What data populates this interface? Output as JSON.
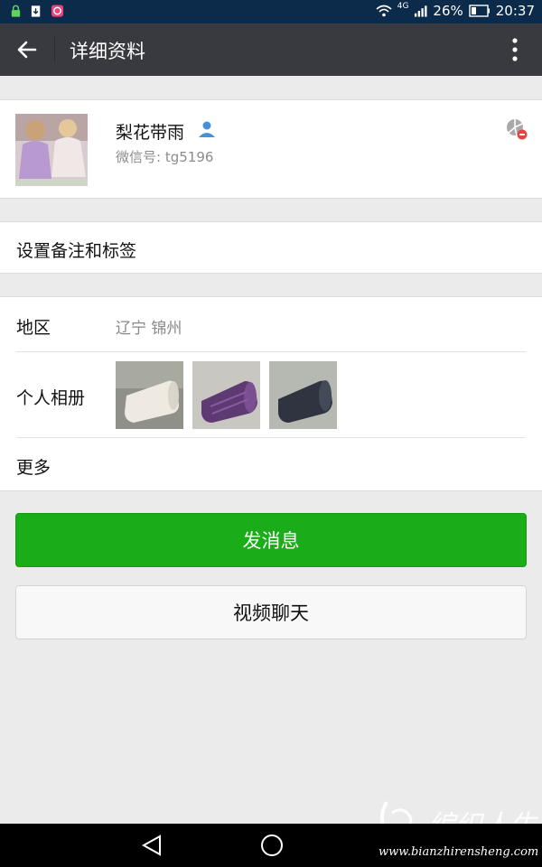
{
  "status_bar": {
    "network": "4G",
    "battery": "26%",
    "time": "20:37"
  },
  "top_bar": {
    "title": "详细资料"
  },
  "profile": {
    "name": "梨花带雨",
    "wxid_label": "微信号: ",
    "wxid_value": "tg5196"
  },
  "remark": {
    "label": "设置备注和标签"
  },
  "info": {
    "region_label": "地区",
    "region_value": "辽宁  锦州",
    "album_label": "个人相册",
    "more_label": "更多"
  },
  "actions": {
    "send_message": "发消息",
    "video_chat": "视频聊天"
  },
  "watermark": {
    "url": "www.bianzhirensheng.com"
  },
  "colors": {
    "primary_green": "#1aad19",
    "top_bar": "#393a3f",
    "status_bar": "#0c2a4a"
  }
}
